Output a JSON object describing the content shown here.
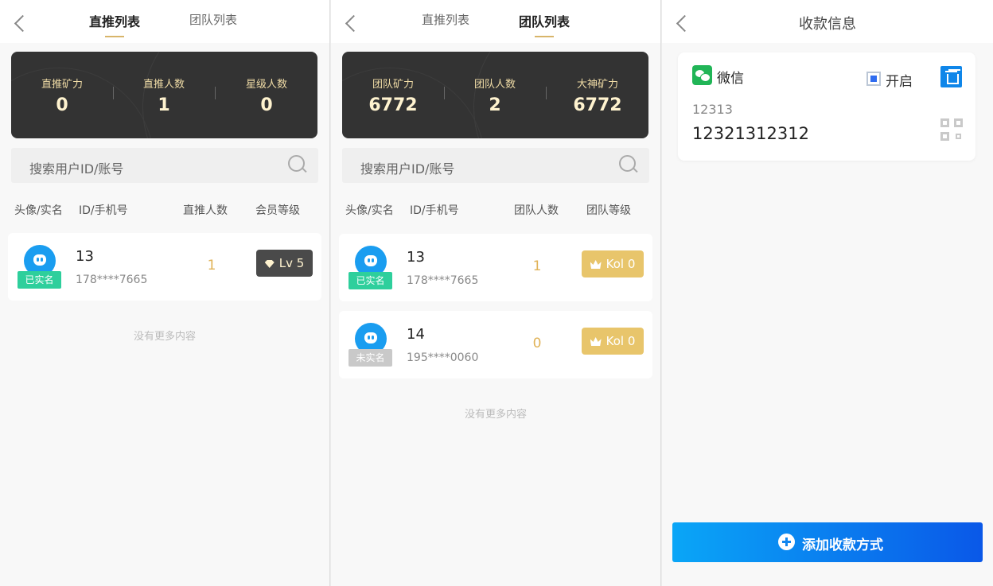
{
  "direct_panel": {
    "tabs": [
      "直推列表",
      "团队列表"
    ],
    "stats": [
      {
        "label": "直推矿力",
        "value": "0"
      },
      {
        "label": "直推人数",
        "value": "1"
      },
      {
        "label": "星级人数",
        "value": "0"
      }
    ],
    "search_placeholder": "搜索用户ID/账号",
    "columns": [
      "头像/实名",
      "ID/手机号",
      "直推人数",
      "会员等级"
    ],
    "rows": [
      {
        "badge": "已实名",
        "id": "13",
        "phone": "178****7665",
        "count": "1",
        "level": "Lv 5"
      }
    ],
    "no_more": "没有更多内容"
  },
  "team_panel": {
    "tabs": [
      "直推列表",
      "团队列表"
    ],
    "stats": [
      {
        "label": "团队矿力",
        "value": "6772"
      },
      {
        "label": "团队人数",
        "value": "2"
      },
      {
        "label": "大神矿力",
        "value": "6772"
      }
    ],
    "search_placeholder": "搜索用户ID/账号",
    "columns": [
      "头像/实名",
      "ID/手机号",
      "团队人数",
      "团队等级"
    ],
    "rows": [
      {
        "badge": "已实名",
        "id": "13",
        "phone": "178****7665",
        "count": "1",
        "level": "Kol 0"
      },
      {
        "badge": "未实名",
        "id": "14",
        "phone": "195****0060",
        "count": "0",
        "level": "Kol 0"
      }
    ],
    "no_more": "没有更多内容"
  },
  "payment_panel": {
    "title": "收款信息",
    "method": {
      "name": "微信",
      "enable_label": "开启",
      "enabled": true,
      "account_name": "12313",
      "account_number": "12321312312"
    },
    "add_button": "添加收款方式"
  },
  "colors": {
    "gold": "#d8b56a",
    "dark_card": "#333333",
    "verified": "#2ecf9c",
    "unverified": "#c9c9c9",
    "primary_blue": "#0a6cf0",
    "wechat_green": "#21b557"
  }
}
